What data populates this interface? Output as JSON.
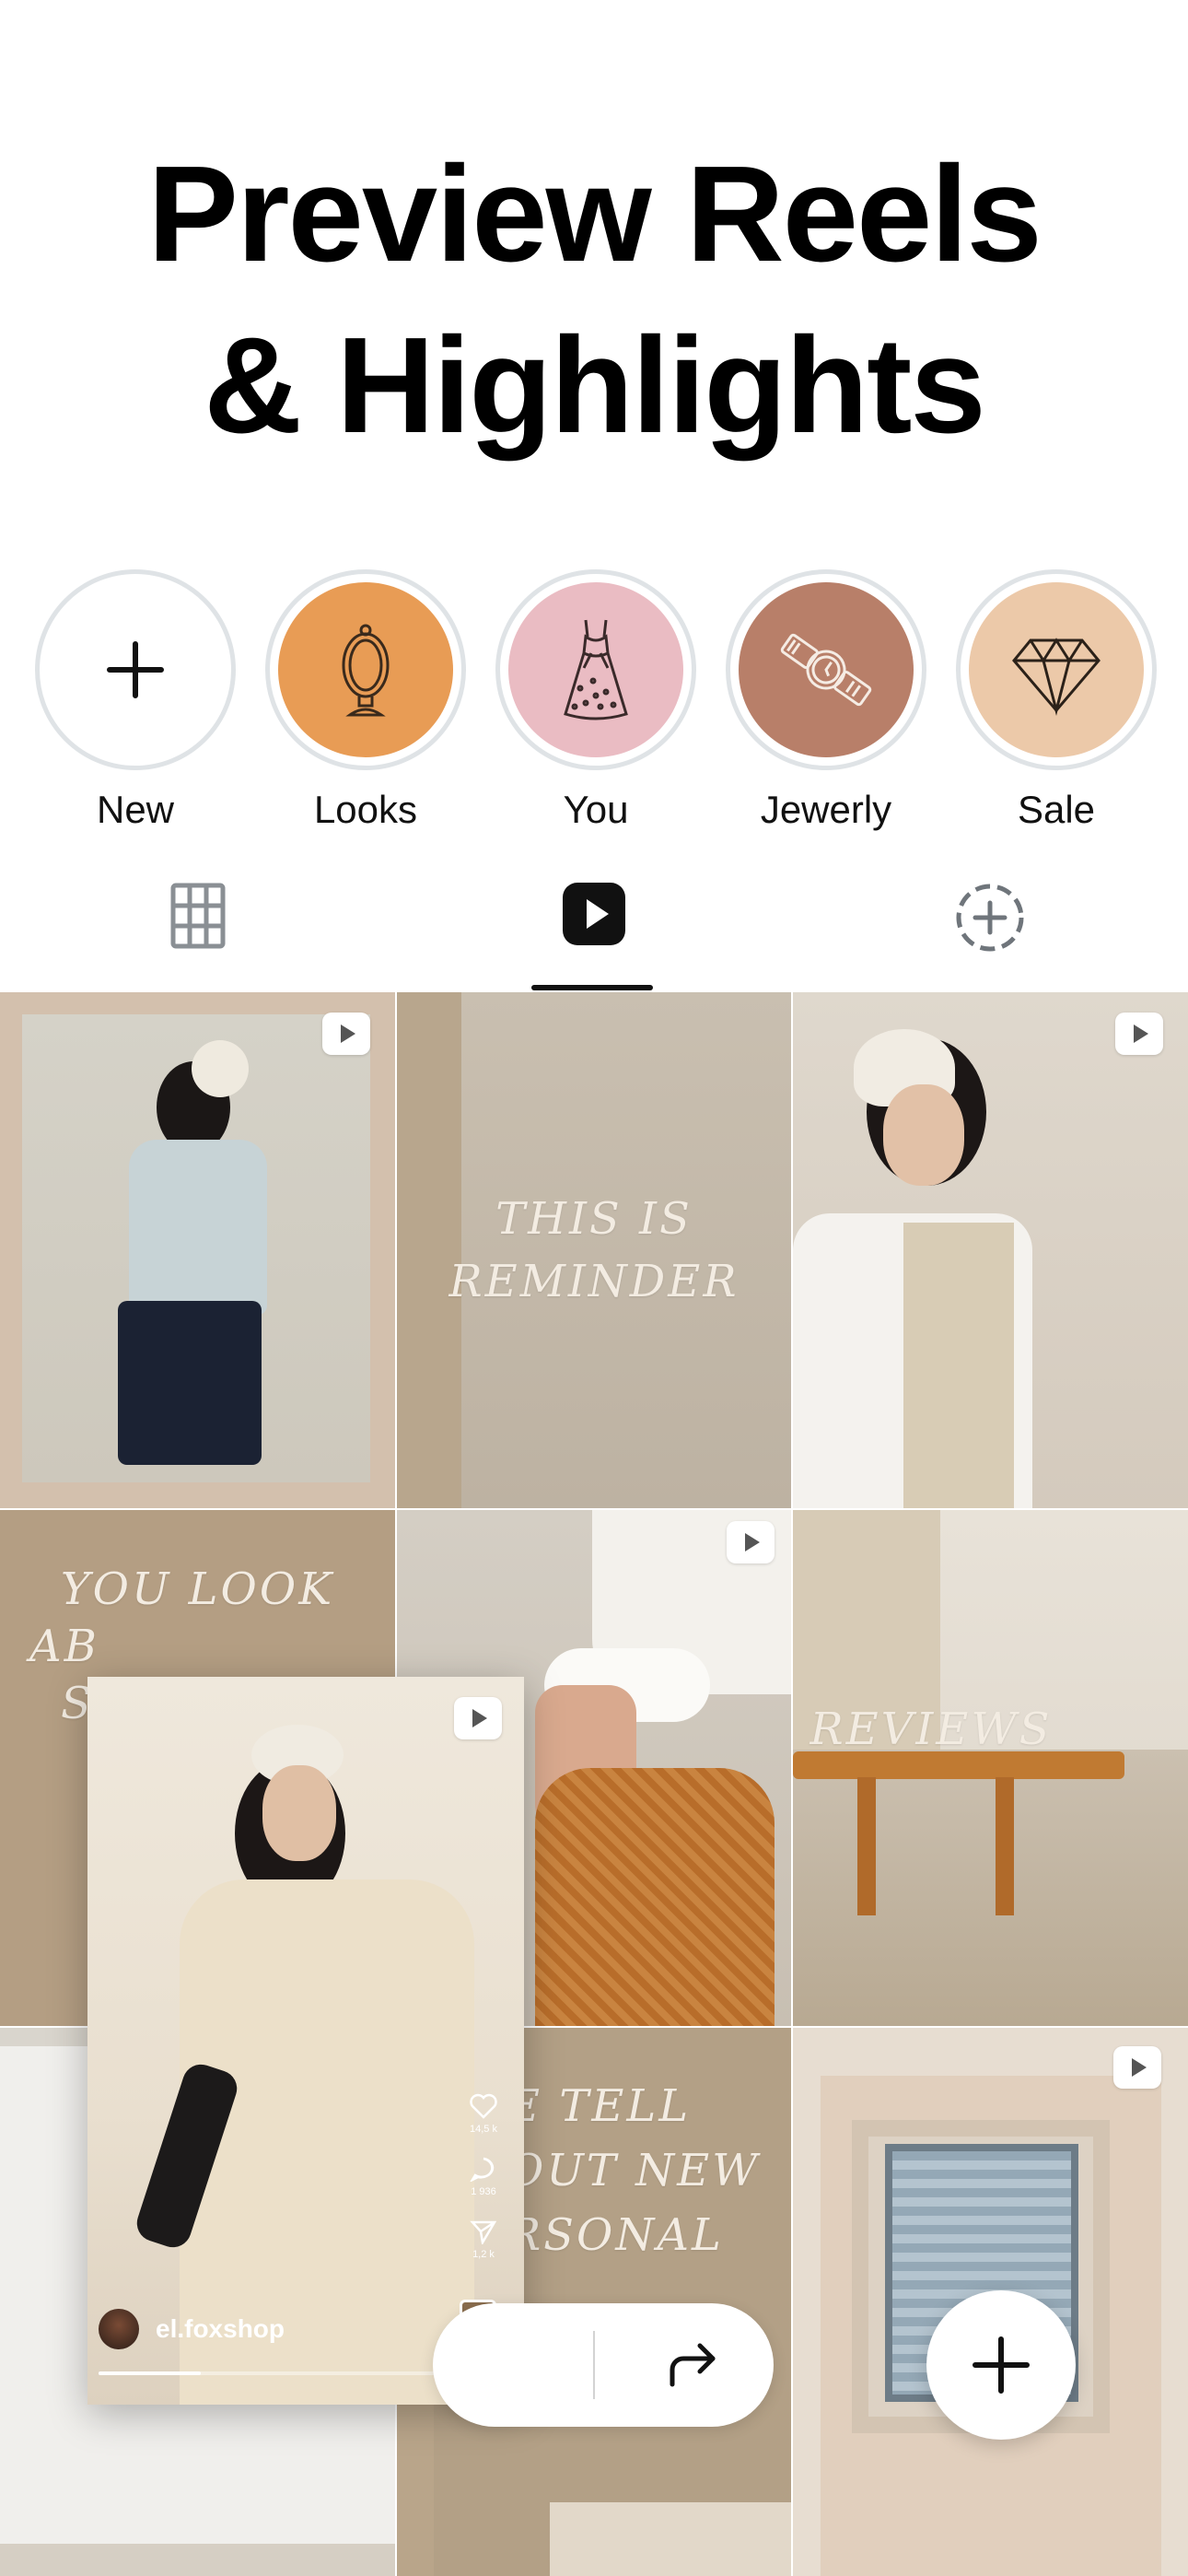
{
  "headline": {
    "line1": "Preview Reels",
    "line2": "& Highlights"
  },
  "highlights": [
    {
      "label": "New",
      "icon": "plus-icon",
      "color": "#ffffff"
    },
    {
      "label": "Looks",
      "icon": "mirror-icon",
      "color": "#e89c55"
    },
    {
      "label": "You",
      "icon": "dress-icon",
      "color": "#eabcc3"
    },
    {
      "label": "Jewerly",
      "icon": "watch-icon",
      "color": "#b87f69"
    },
    {
      "label": "Sale",
      "icon": "diamond-icon",
      "color": "#ecc9a9"
    }
  ],
  "tabs": [
    {
      "icon": "grid-icon",
      "active": false
    },
    {
      "icon": "reels-icon",
      "active": true
    },
    {
      "icon": "add-collab-icon",
      "active": false
    }
  ],
  "grid_text": {
    "reminder_line1": "THIS IS",
    "reminder_line2": "REMINDER",
    "you_look_line1": "YOU LOOK",
    "you_look_line2": "AB",
    "you_look_line3": "S",
    "reviews": "REVIEWS",
    "tell_line1": "E TELL",
    "tell_line2": "OUT NEW",
    "tell_line3": "RSONAL"
  },
  "reel_card": {
    "username": "el.foxshop",
    "likes": "14,5 k",
    "comments": "1 936",
    "shares": "1,2 k"
  },
  "colors": {
    "accent_dark": "#111111",
    "tab_inactive": "#8a8f94",
    "beige": "#b9a68c"
  }
}
